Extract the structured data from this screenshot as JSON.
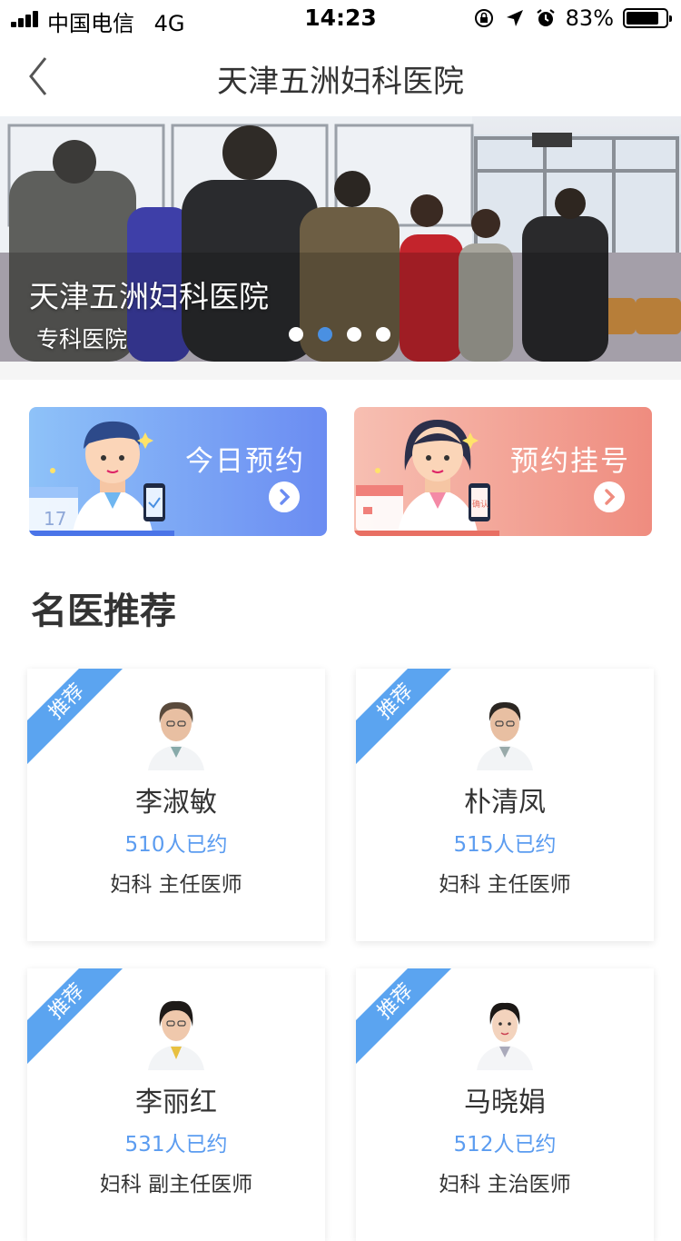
{
  "status_bar": {
    "carrier": "中国电信",
    "network": "4G",
    "time": "14:23",
    "battery_percent": "83%",
    "battery_level": 0.83
  },
  "nav": {
    "title": "天津五洲妇科医院"
  },
  "banner": {
    "title": "天津五洲妇科医院",
    "subtitle": "专科医院",
    "slide_count": 4,
    "active_slide": 2
  },
  "actions": {
    "today": {
      "label": "今日预约",
      "calendar_day": "17"
    },
    "book": {
      "label": "预约挂号",
      "phone_text": "确认"
    }
  },
  "section": {
    "title": "名医推荐"
  },
  "doctors": [
    {
      "badge": "推荐",
      "name": "李淑敏",
      "booked": "510人已约",
      "dept": "妇科  主任医师"
    },
    {
      "badge": "推荐",
      "name": "朴清凤",
      "booked": "515人已约",
      "dept": "妇科  主任医师"
    },
    {
      "badge": "推荐",
      "name": "李丽红",
      "booked": "531人已约",
      "dept": "妇科  副主任医师"
    },
    {
      "badge": "推荐",
      "name": "马晓娟",
      "booked": "512人已约",
      "dept": "妇科  主治医师"
    }
  ],
  "colors": {
    "accent": "#4a90e2",
    "link_blue": "#5b9cf0",
    "ribbon": "#5ba4f0"
  },
  "icons": {
    "back": "chevron-left-icon",
    "arrow": "chevron-right-icon"
  }
}
